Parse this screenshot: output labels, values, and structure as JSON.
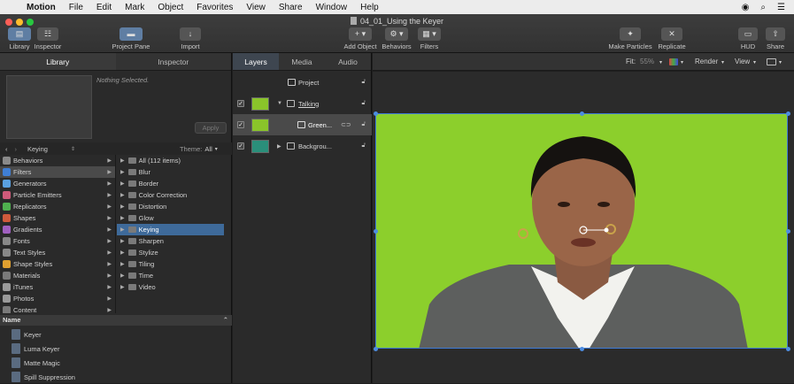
{
  "menubar": {
    "app_name": "Motion",
    "items": [
      "File",
      "Edit",
      "Mark",
      "Object",
      "Favorites",
      "View",
      "Share",
      "Window",
      "Help"
    ]
  },
  "window": {
    "title": "04_01_Using the Keyer"
  },
  "toolbar": {
    "library_label": "Library",
    "inspector_label": "Inspector",
    "project_pane_label": "Project Pane",
    "import_label": "Import",
    "add_object_label": "Add Object",
    "behaviors_label": "Behaviors",
    "filters_label": "Filters",
    "make_particles_label": "Make Particles",
    "replicate_label": "Replicate",
    "hud_label": "HUD",
    "share_label": "Share"
  },
  "left_panel": {
    "tabs": [
      "Library",
      "Inspector"
    ],
    "nothing_selected": "Nothing Selected.",
    "apply_label": "Apply",
    "path_label": "Keying",
    "theme_label": "Theme:",
    "theme_value": "All",
    "categories": [
      {
        "label": "Behaviors",
        "icon": "gear-icon",
        "color": "#8a8a8a"
      },
      {
        "label": "Filters",
        "icon": "filters-icon",
        "color": "#3f7fd6"
      },
      {
        "label": "Generators",
        "icon": "generators-icon",
        "color": "#5aa0e0"
      },
      {
        "label": "Particle Emitters",
        "icon": "particles-icon",
        "color": "#d05a7a"
      },
      {
        "label": "Replicators",
        "icon": "replicator-icon",
        "color": "#4fb04f"
      },
      {
        "label": "Shapes",
        "icon": "shapes-icon",
        "color": "#d05a3c"
      },
      {
        "label": "Gradients",
        "icon": "gradients-icon",
        "color": "#a060c0"
      },
      {
        "label": "Fonts",
        "icon": "fonts-icon",
        "color": "#888888"
      },
      {
        "label": "Text Styles",
        "icon": "text-styles-icon",
        "color": "#888888"
      },
      {
        "label": "Shape Styles",
        "icon": "shape-styles-icon",
        "color": "#e0a030"
      },
      {
        "label": "Materials",
        "icon": "materials-icon",
        "color": "#7a7a7a"
      },
      {
        "label": "iTunes",
        "icon": "itunes-icon",
        "color": "#9a9a9a"
      },
      {
        "label": "Photos",
        "icon": "photos-icon",
        "color": "#9a9a9a"
      },
      {
        "label": "Content",
        "icon": "content-icon",
        "color": "#7a7a7a"
      }
    ],
    "subcategories": [
      "All (112 items)",
      "Blur",
      "Border",
      "Color Correction",
      "Distortion",
      "Glow",
      "Keying",
      "Sharpen",
      "Stylize",
      "Tiling",
      "Time",
      "Video"
    ],
    "name_header": "Name",
    "items": [
      "Keyer",
      "Luma Keyer",
      "Matte Magic",
      "Spill Suppression"
    ]
  },
  "layers_panel": {
    "tabs": [
      "Layers",
      "Media",
      "Audio"
    ],
    "project_label": "Project",
    "rows": [
      {
        "label": "Talking"
      },
      {
        "label": "Green..."
      },
      {
        "label": "Backgrou..."
      }
    ]
  },
  "viewer": {
    "fit_label": "Fit:",
    "fit_value": "55%",
    "render_label": "Render",
    "view_label": "View"
  },
  "colors": {
    "accent": "#3e6a9a",
    "keyer_green": "#8ccf2c",
    "selection_blue": "#3e7bd6"
  }
}
